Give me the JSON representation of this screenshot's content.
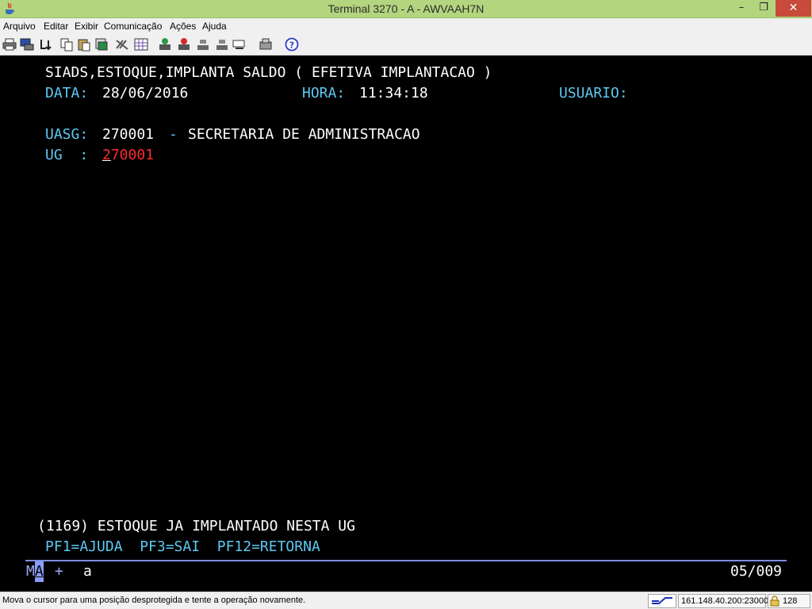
{
  "window": {
    "title": "Terminal 3270 - A - AWVAAH7N",
    "min_glyph": "–",
    "max_glyph": "❐",
    "close_glyph": "✕"
  },
  "menu": [
    "Arquivo",
    "Editar",
    "Exibir",
    "Comunicação",
    "Ações",
    "Ajuda"
  ],
  "toolbar_icons": [
    "print-icon",
    "print-screen-icon",
    "transfer-icon",
    "copy-icon",
    "paste-icon",
    "paste-clipboard-icon",
    "edit-macro-icon",
    "keypad-icon",
    "send-file-icon",
    "receive-file-icon",
    "record-icon",
    "play-icon",
    "display-icon",
    "session-icon",
    "help-icon"
  ],
  "screen": {
    "title": "SIADS,ESTOQUE,IMPLANTA SALDO ( EFETIVA IMPLANTACAO )",
    "data_label": "DATA:",
    "data_value": "28/06/2016",
    "hora_label": "HORA:",
    "hora_value": "11:34:18",
    "usuario_label": "USUARIO:",
    "uasg_label": "UASG:",
    "uasg_value": "270001",
    "uasg_dash": "-",
    "uasg_desc": "SECRETARIA DE ADMINISTRACAO",
    "ug_label": "UG  :",
    "ug_value_first": "2",
    "ug_value_rest": "70001",
    "message": "(1169) ESTOQUE JA IMPLANTADO NESTA UG",
    "pf_keys": "PF1=AJUDA  PF3=SAI  PF12=RETORNA"
  },
  "oia": {
    "m": "M",
    "a_cursor": "A",
    "plus": "+",
    "lower_a": "a",
    "position": "05/009"
  },
  "status": {
    "message": "Mova o cursor para uma posição desprotegida e tente a operação novamente.",
    "host": "161.148.40.200:23000",
    "encryption": "128"
  },
  "colors": {
    "titlebar": "#b3d57e",
    "terminal_bg": "#000000",
    "field_cyan": "#5ec8f2",
    "input_red": "#ff2a2a",
    "oia_blue": "#9aaaf5"
  }
}
